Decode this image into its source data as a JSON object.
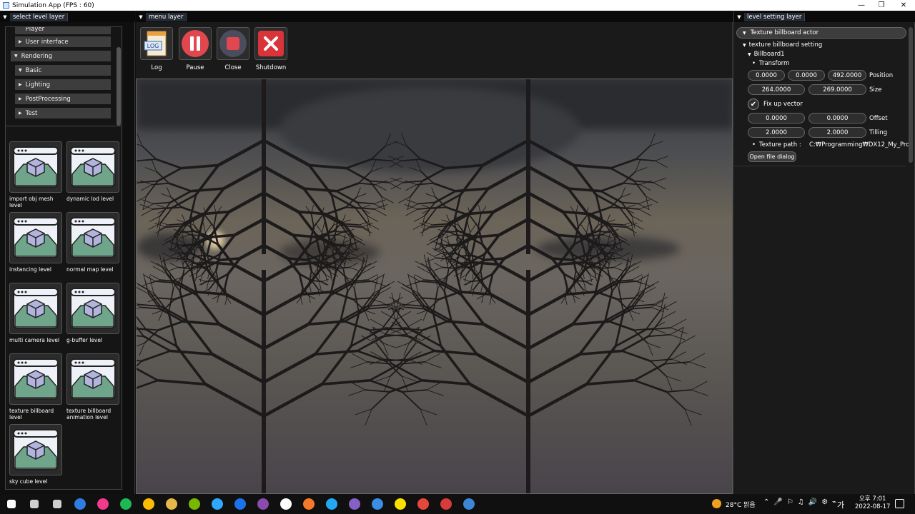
{
  "window": {
    "title": "Simulation App (FPS : 60)",
    "controls": [
      "minimize",
      "maximize",
      "close"
    ]
  },
  "left_panel": {
    "title": "select level layer",
    "tree": [
      {
        "label": "Player",
        "indent": 2,
        "arrow": false
      },
      {
        "label": "User interface",
        "indent": 2,
        "arrow": true,
        "expanded": false
      },
      {
        "label": "Rendering",
        "indent": 1,
        "arrow": true,
        "expanded": true
      },
      {
        "label": "Basic",
        "indent": 2,
        "arrow": true,
        "expanded": true
      },
      {
        "label": "Lighting",
        "indent": 2,
        "arrow": true,
        "expanded": false
      },
      {
        "label": "PostProcessing",
        "indent": 2,
        "arrow": true,
        "expanded": false
      },
      {
        "label": "Test",
        "indent": 2,
        "arrow": true,
        "expanded": false
      }
    ],
    "levels": [
      "import obj mesh level",
      "dynamic lod level",
      "instancing level",
      "normal map level",
      "multi camera level",
      "g-buffer level",
      "texture billboard level",
      "texture billboard animation level",
      "sky cube level"
    ]
  },
  "menu_panel": {
    "title": "menu layer",
    "buttons": [
      {
        "label": "Log",
        "icon": "log-icon"
      },
      {
        "label": "Pause",
        "icon": "pause-icon"
      },
      {
        "label": "Close",
        "icon": "stop-icon"
      },
      {
        "label": "Shutdown",
        "icon": "close-icon"
      }
    ]
  },
  "right_panel": {
    "title": "level setting layer",
    "actor": "Texture billboard actor",
    "setting": "texture billboard setting",
    "billboard": "Billboard1",
    "transform": "Transform",
    "position": {
      "label": "Position",
      "values": [
        "0.0000",
        "0.0000",
        "492.0000"
      ]
    },
    "size": {
      "label": "Size",
      "values": [
        "264.0000",
        "269.0000"
      ]
    },
    "fix_up_vector": {
      "label": "Fix up vector",
      "checked": true
    },
    "offset": {
      "label": "Offset",
      "values": [
        "0.0000",
        "0.0000"
      ]
    },
    "tilling": {
      "label": "Tilling",
      "values": [
        "2.0000",
        "2.0000"
      ]
    },
    "texture_path": {
      "label": "Texture path :",
      "value": "C:₩Programming₩DX12_My_Pro"
    },
    "open_file": "Open file dialog"
  },
  "taskbar": {
    "weather": "28°C 맑음",
    "time": "오후 7:01",
    "date": "2022-08-17",
    "language": "가",
    "apps": [
      "windows-start",
      "search",
      "task-view",
      "todo",
      "itunes",
      "spotify",
      "chrome",
      "file-explorer",
      "nvidia",
      "photoshop",
      "maps",
      "github",
      "unreal",
      "blender",
      "vscode",
      "visual-studio",
      "krita",
      "kakaotalk",
      "clock",
      "pen",
      "simulation-app"
    ]
  },
  "colors": {
    "panel_bg": "#1a1a1a",
    "header_bg": "#0a0a0a",
    "node_bg": "#3d3d3d",
    "pause_red": "#e0474e",
    "shutdown_red": "#d93439"
  }
}
